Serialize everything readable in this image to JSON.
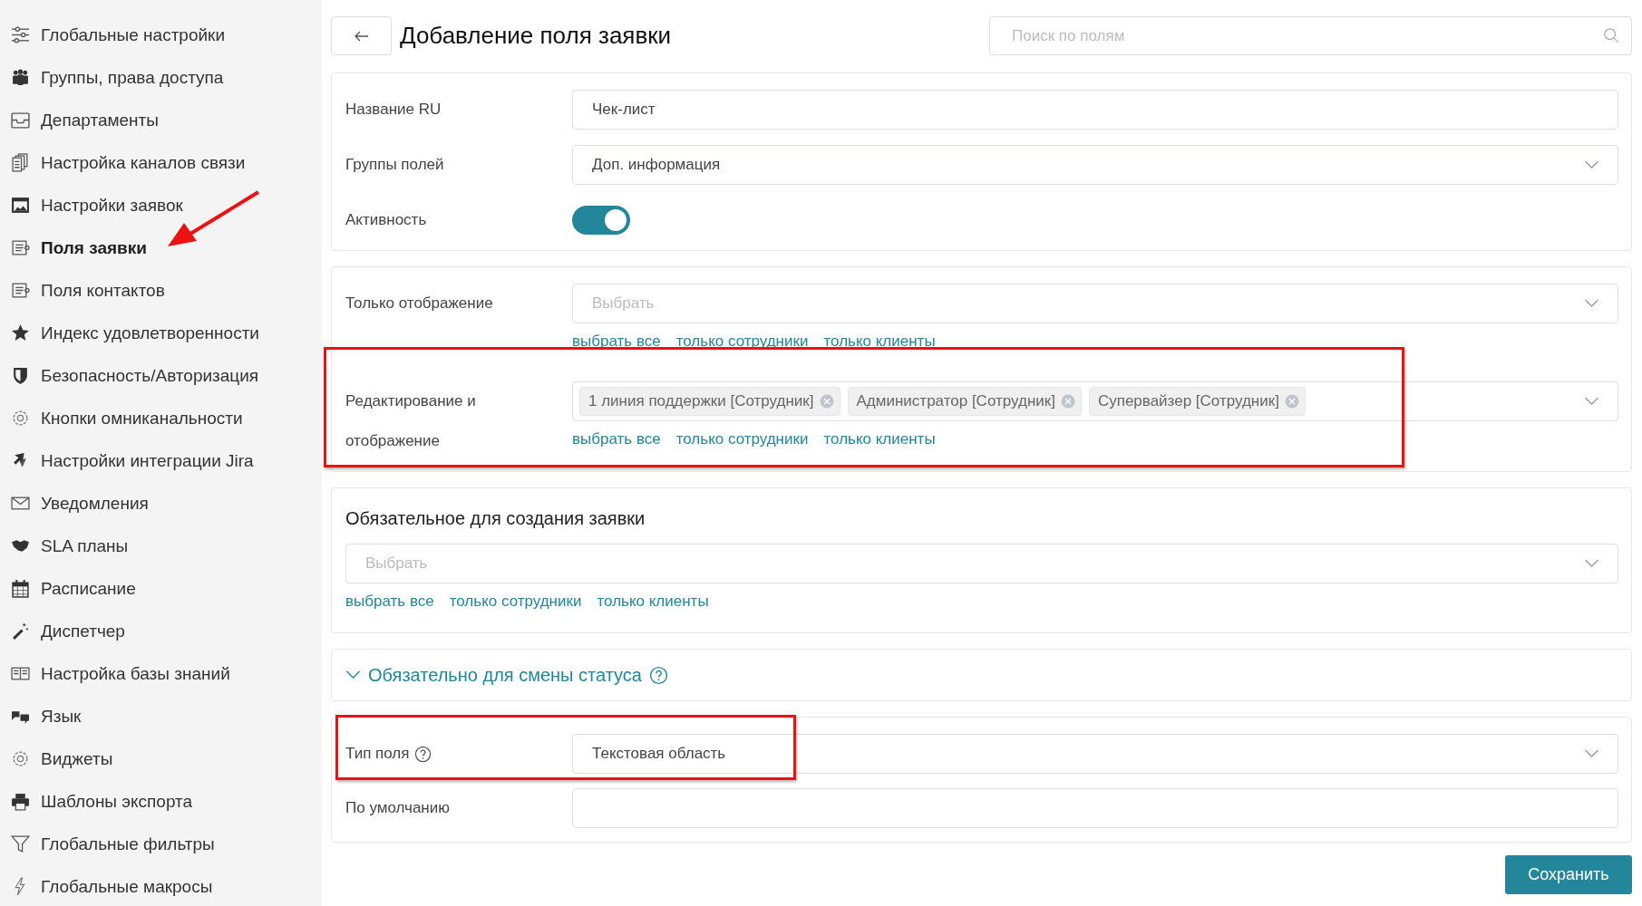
{
  "sidebar": {
    "items": [
      {
        "label": "Глобальные настройки",
        "selected": false
      },
      {
        "label": "Группы, права доступа",
        "selected": false
      },
      {
        "label": "Департаменты",
        "selected": false
      },
      {
        "label": "Настройка каналов связи",
        "selected": false
      },
      {
        "label": "Настройки заявок",
        "selected": false
      },
      {
        "label": "Поля заявки",
        "selected": true
      },
      {
        "label": "Поля контактов",
        "selected": false
      },
      {
        "label": "Индекс удовлетворенности",
        "selected": false
      },
      {
        "label": "Безопасность/Авторизация",
        "selected": false
      },
      {
        "label": "Кнопки омниканальности",
        "selected": false
      },
      {
        "label": "Настройки интеграции Jira",
        "selected": false
      },
      {
        "label": "Уведомления",
        "selected": false
      },
      {
        "label": "SLA планы",
        "selected": false
      },
      {
        "label": "Расписание",
        "selected": false
      },
      {
        "label": "Диспетчер",
        "selected": false
      },
      {
        "label": "Настройка базы знаний",
        "selected": false
      },
      {
        "label": "Язык",
        "selected": false
      },
      {
        "label": "Виджеты",
        "selected": false
      },
      {
        "label": "Шаблоны экспорта",
        "selected": false
      },
      {
        "label": "Глобальные фильтры",
        "selected": false
      },
      {
        "label": "Глобальные макросы",
        "selected": false
      }
    ]
  },
  "header": {
    "title": "Добавление поля заявки",
    "search": {
      "placeholder": "Поиск по полям"
    }
  },
  "general": {
    "rows": [
      {
        "kind": "text",
        "label": "Название RU",
        "value": "Чек-лист"
      },
      {
        "kind": "select",
        "label": "Группы полей",
        "value": "Доп. информация"
      },
      {
        "kind": "toggle",
        "label": "Активность",
        "on": true
      }
    ]
  },
  "access": {
    "rows": [
      {
        "label": "Только отображение",
        "placeholder": "Выбрать",
        "links": [
          "выбрать все",
          "только сотрудники",
          "только клиенты"
        ]
      },
      {
        "label": "Редактирование и отображение",
        "tags": [
          "1 линия поддержки [Сотрудник]",
          "Администратор [Сотрудник]",
          "Супервайзер [Сотрудник]"
        ],
        "links": [
          "выбрать все",
          "только сотрудники",
          "только клиенты"
        ]
      }
    ]
  },
  "required_create": {
    "title": "Обязательное для создания заявки",
    "placeholder": "Выбрать",
    "links": [
      "выбрать все",
      "только сотрудники",
      "только клиенты"
    ]
  },
  "required_status": {
    "title": "Обязательно для смены статуса",
    "expanded": false
  },
  "type": {
    "rows": [
      {
        "kind": "select",
        "label": "Тип поля",
        "help": true,
        "value": "Текстовая область"
      },
      {
        "kind": "text",
        "label": "По умолчанию",
        "help": false
      }
    ]
  },
  "save_button": "Сохранить"
}
